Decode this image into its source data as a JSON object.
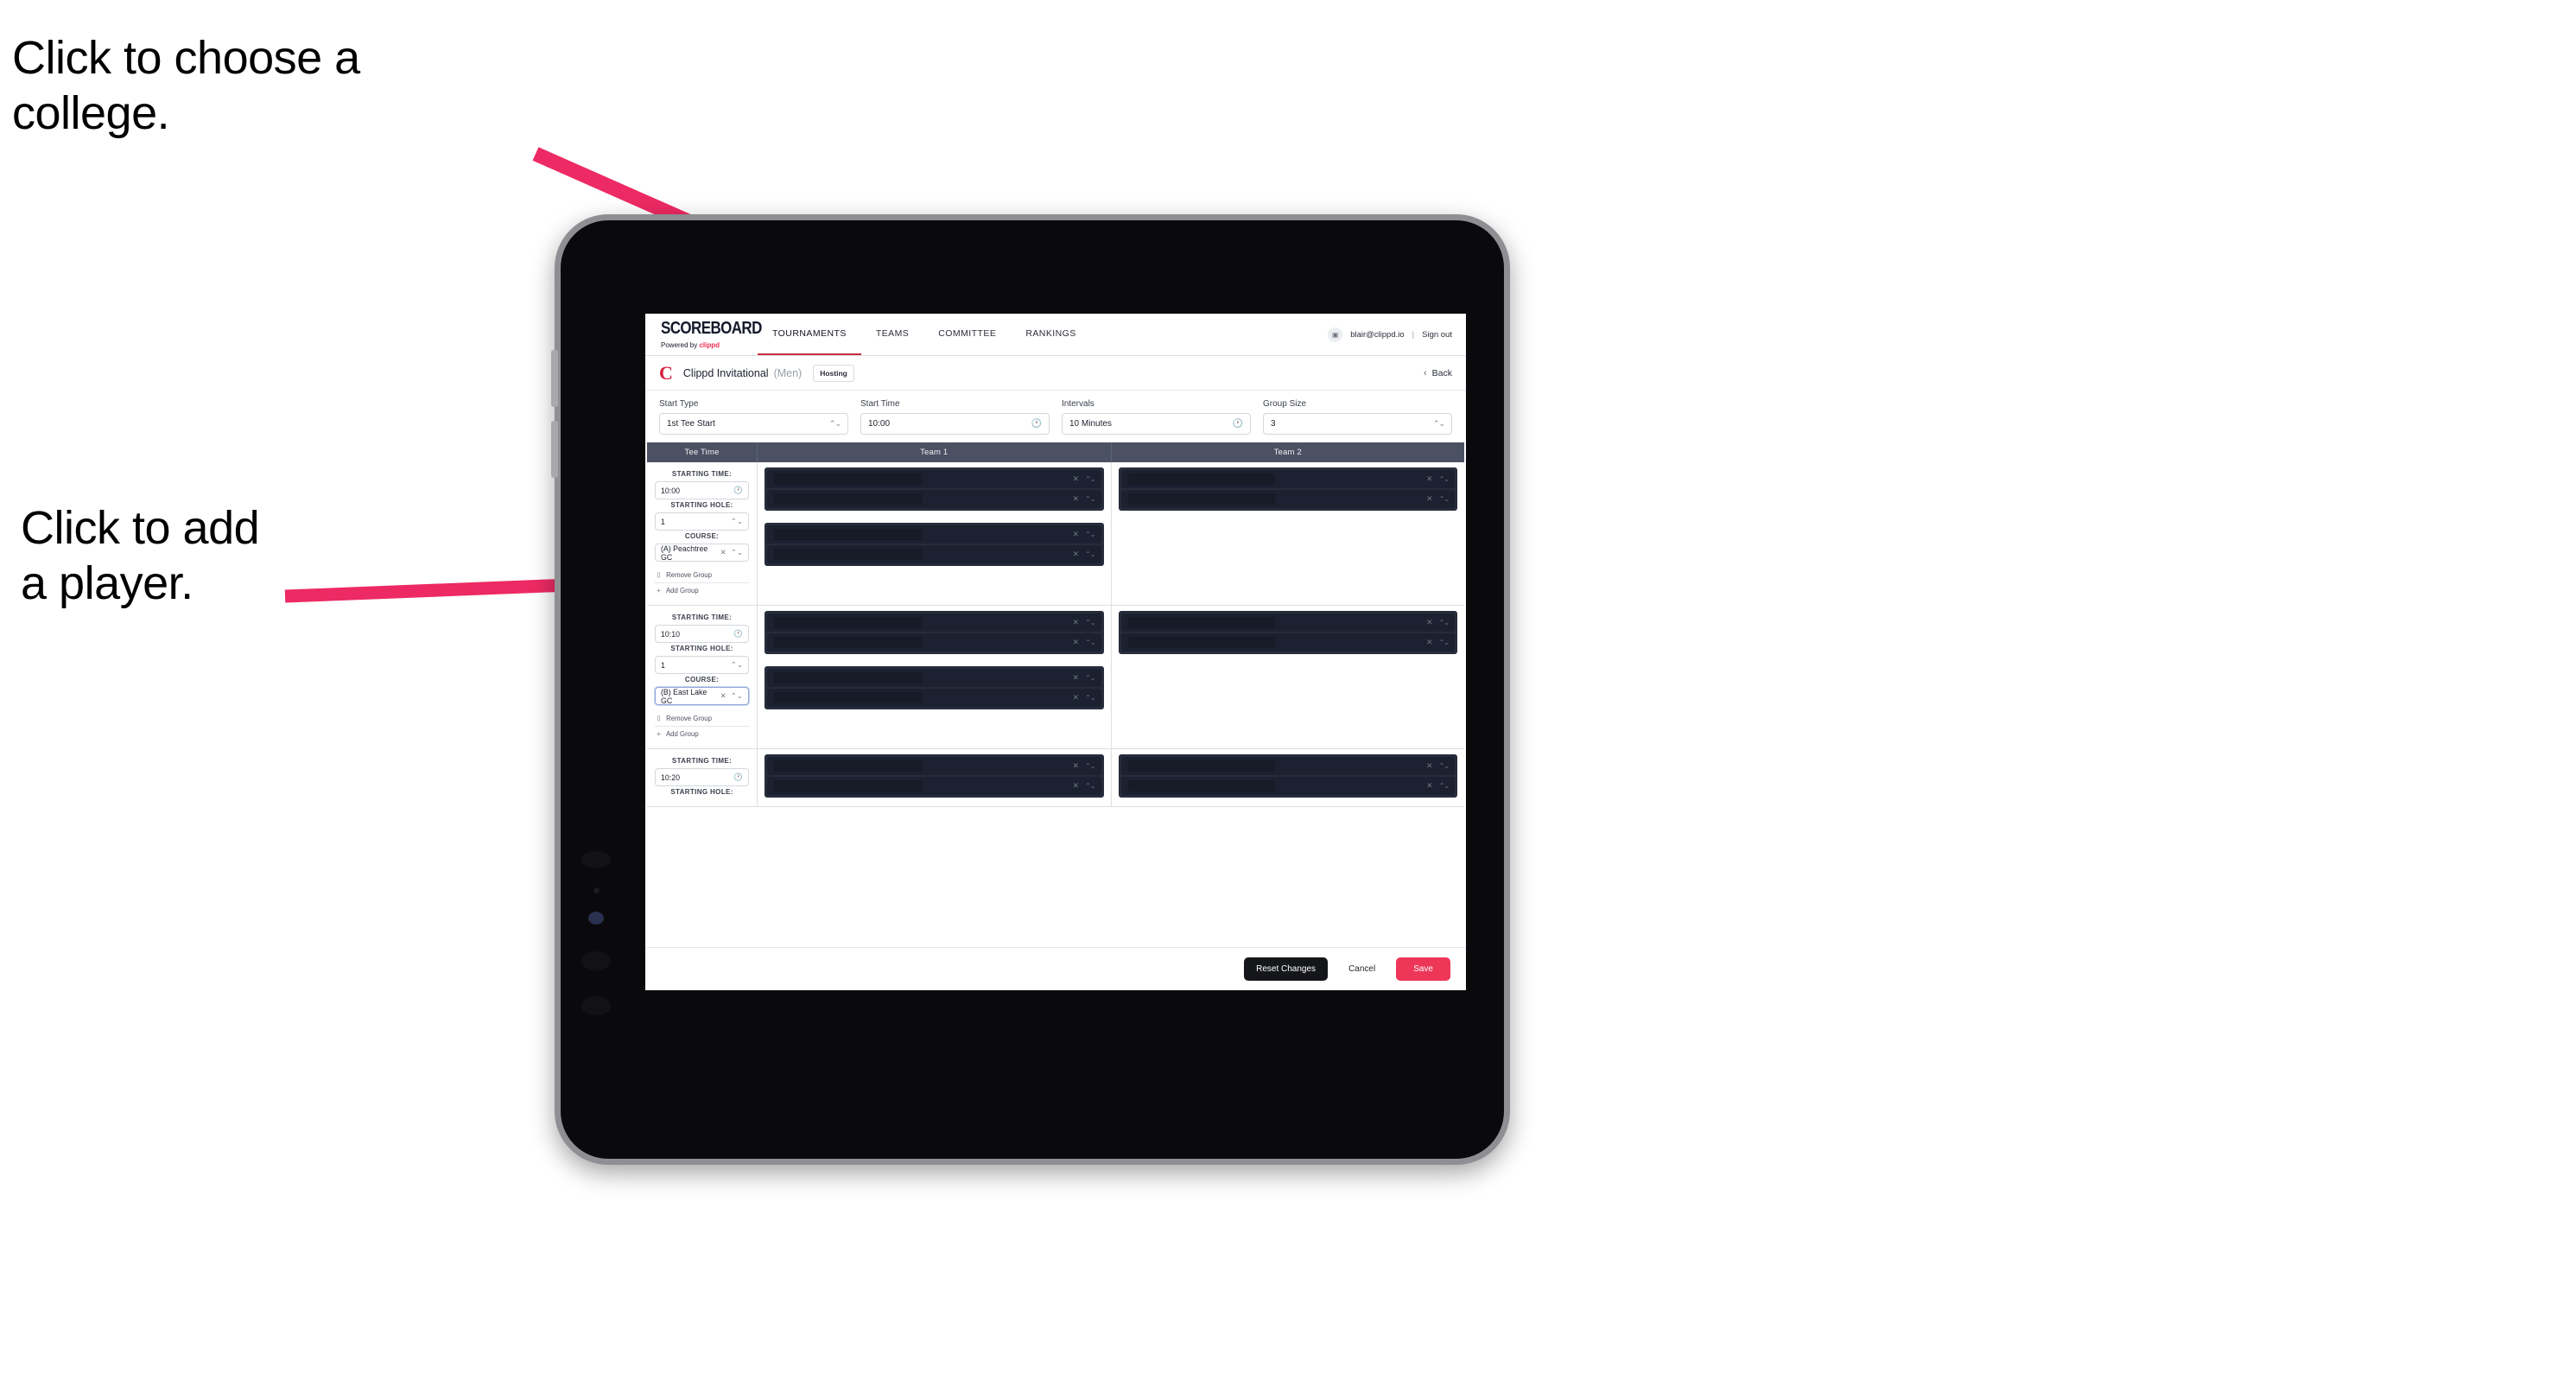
{
  "annotations": {
    "college": "Click to choose a\ncollege.",
    "player": "Click to add\na player.",
    "arrow_color": "#ed2a63"
  },
  "nav": {
    "brand_title": "SCOREBOARD",
    "brand_sub_prefix": "Powered by ",
    "brand_sub_brand": "clippd",
    "items": [
      {
        "label": "TOURNAMENTS",
        "active": true
      },
      {
        "label": "TEAMS",
        "active": false
      },
      {
        "label": "COMMITTEE",
        "active": false
      },
      {
        "label": "RANKINGS",
        "active": false
      }
    ],
    "avatar_glyph": "▣",
    "email": "blair@clippd.io",
    "separator": "|",
    "sign_out": "Sign out"
  },
  "tournament_bar": {
    "logo_letter": "C",
    "name": "Clippd Invitational",
    "gender": "(Men)",
    "badge": "Hosting",
    "back_chevron": "‹",
    "back_label": "Back"
  },
  "controls": [
    {
      "label": "Start Type",
      "value": "1st Tee Start",
      "icon": "spinner-icon",
      "glyph": "⌃⌄"
    },
    {
      "label": "Start Time",
      "value": "10:00",
      "icon": "clock-icon",
      "glyph": "🕐"
    },
    {
      "label": "Intervals",
      "value": "10 Minutes",
      "icon": "clock-icon",
      "glyph": "🕐"
    },
    {
      "label": "Group Size",
      "value": "3",
      "icon": "spinner-icon",
      "glyph": "⌃⌄"
    }
  ],
  "table": {
    "headers": [
      "Tee Time",
      "Team 1",
      "Team 2"
    ],
    "field_labels": {
      "starting_time": "STARTING TIME:",
      "starting_hole": "STARTING HOLE:",
      "course": "COURSE:"
    },
    "group_actions": {
      "remove": "Remove Group",
      "remove_icon": "trash-icon",
      "remove_glyph": "⌷",
      "add": "Add Group",
      "add_icon": "plus-icon",
      "add_glyph": "+"
    },
    "clock_glyph": "🕐",
    "spinner_glyph": "⌃⌄",
    "clear_glyph": "✕",
    "rows": [
      {
        "starting_time": "10:00",
        "starting_hole": "1",
        "course": "(A) Peachtree GC",
        "course_focused": false,
        "team1_groups": [
          2,
          2
        ],
        "team2_groups": [
          2
        ]
      },
      {
        "starting_time": "10:10",
        "starting_hole": "1",
        "course": "(B) East Lake GC",
        "course_focused": true,
        "team1_groups": [
          2,
          2
        ],
        "team2_groups": [
          2
        ]
      },
      {
        "starting_time": "10:20",
        "starting_hole": "",
        "course": "",
        "course_focused": false,
        "team1_groups": [
          2
        ],
        "team2_groups": [
          2
        ],
        "partial": true
      }
    ]
  },
  "footer": {
    "reset": "Reset Changes",
    "cancel": "Cancel",
    "save": "Save"
  }
}
